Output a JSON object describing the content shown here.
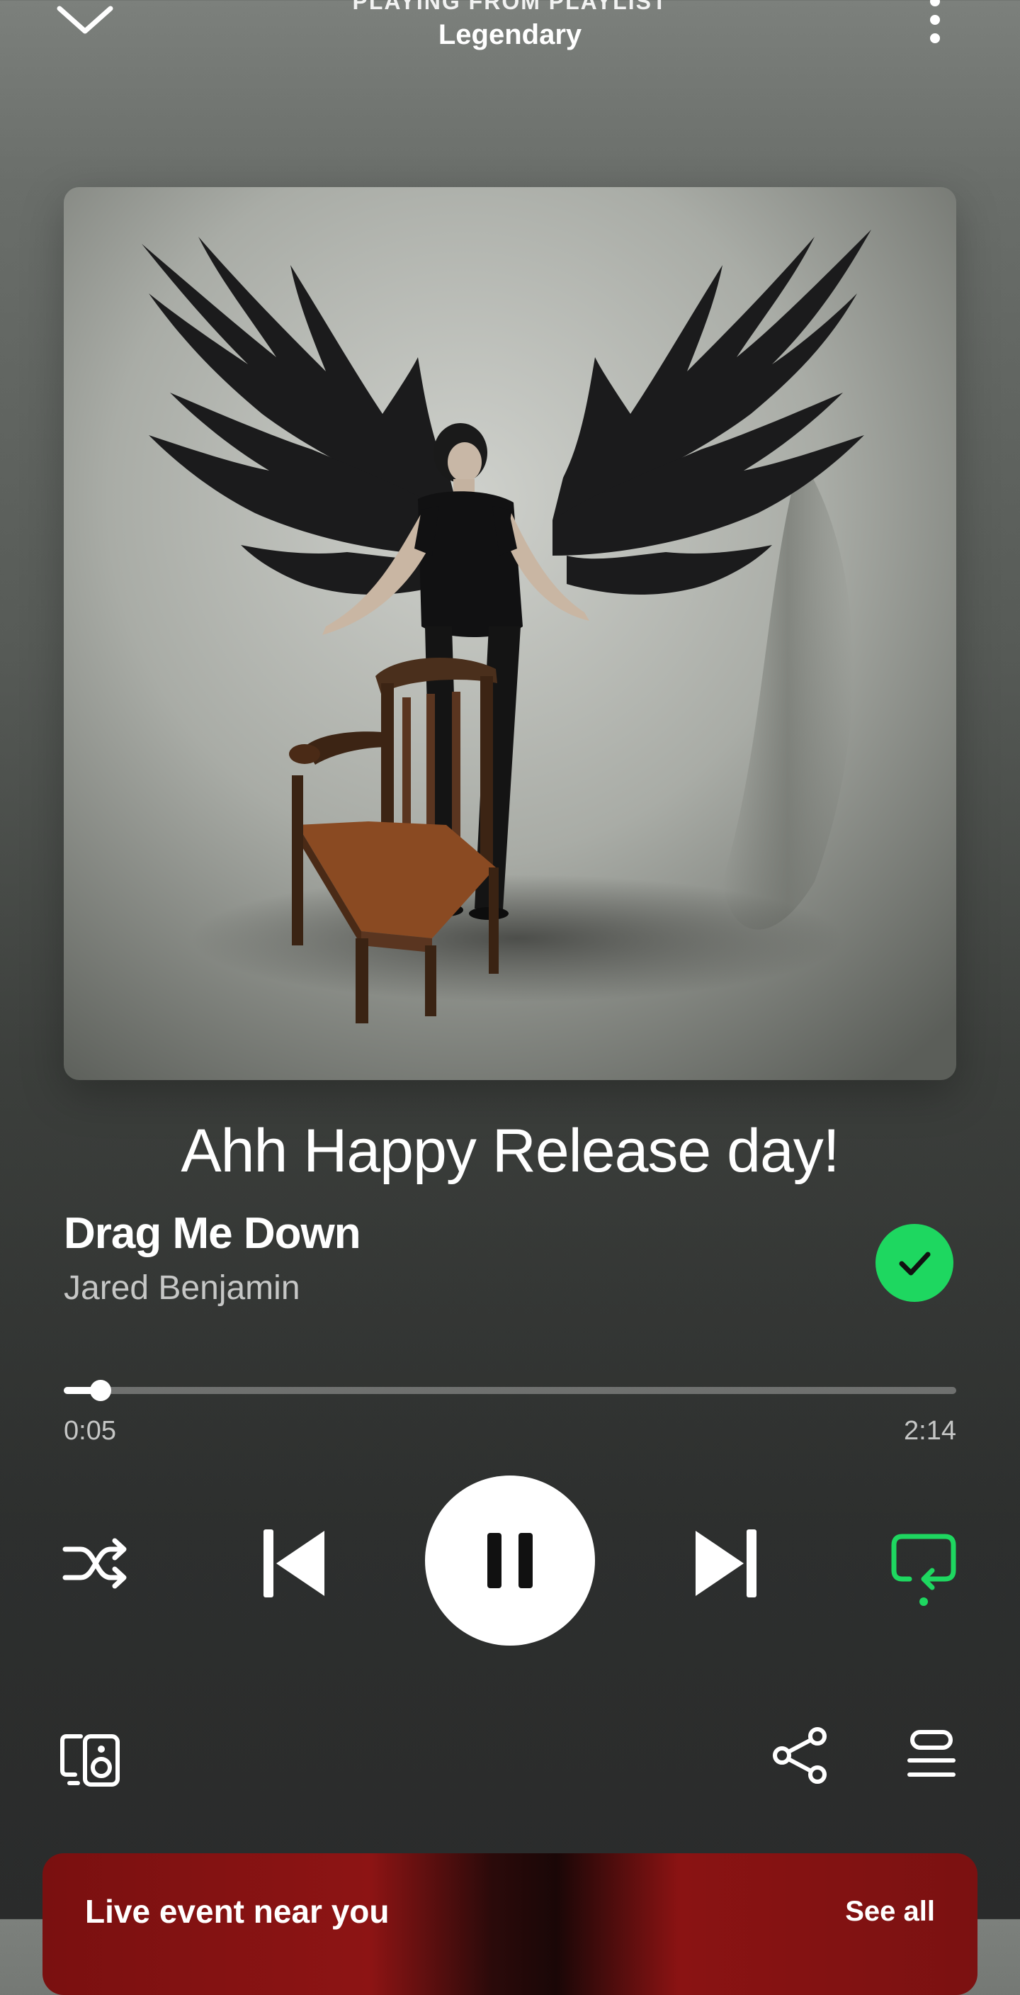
{
  "header": {
    "context_label": "PLAYING FROM PLAYLIST",
    "playlist_name": "Legendary"
  },
  "icons": {
    "collapse": "chevron-down-icon",
    "menu": "more-vertical-icon",
    "liked": "check-icon",
    "shuffle": "shuffle-icon",
    "previous": "skip-previous-icon",
    "play_pause": "pause-icon",
    "next": "skip-next-icon",
    "repeat": "repeat-icon",
    "devices": "connect-devices-icon",
    "share": "share-icon",
    "queue": "queue-icon"
  },
  "lyrics": {
    "current_line": "Ahh Happy Release day!"
  },
  "track": {
    "title": "Drag Me Down",
    "artist": "Jared Benjamin",
    "liked": true
  },
  "progress": {
    "elapsed": "0:05",
    "total": "2:14",
    "fraction": 0.0415
  },
  "controls": {
    "shuffle_active": false,
    "playing": true,
    "repeat_active": true
  },
  "live_card": {
    "title": "Live event near you",
    "link": "See all"
  },
  "colors": {
    "accent_green": "#1ed760",
    "text_primary": "#ffffff",
    "text_secondary": "#b8bab8"
  }
}
